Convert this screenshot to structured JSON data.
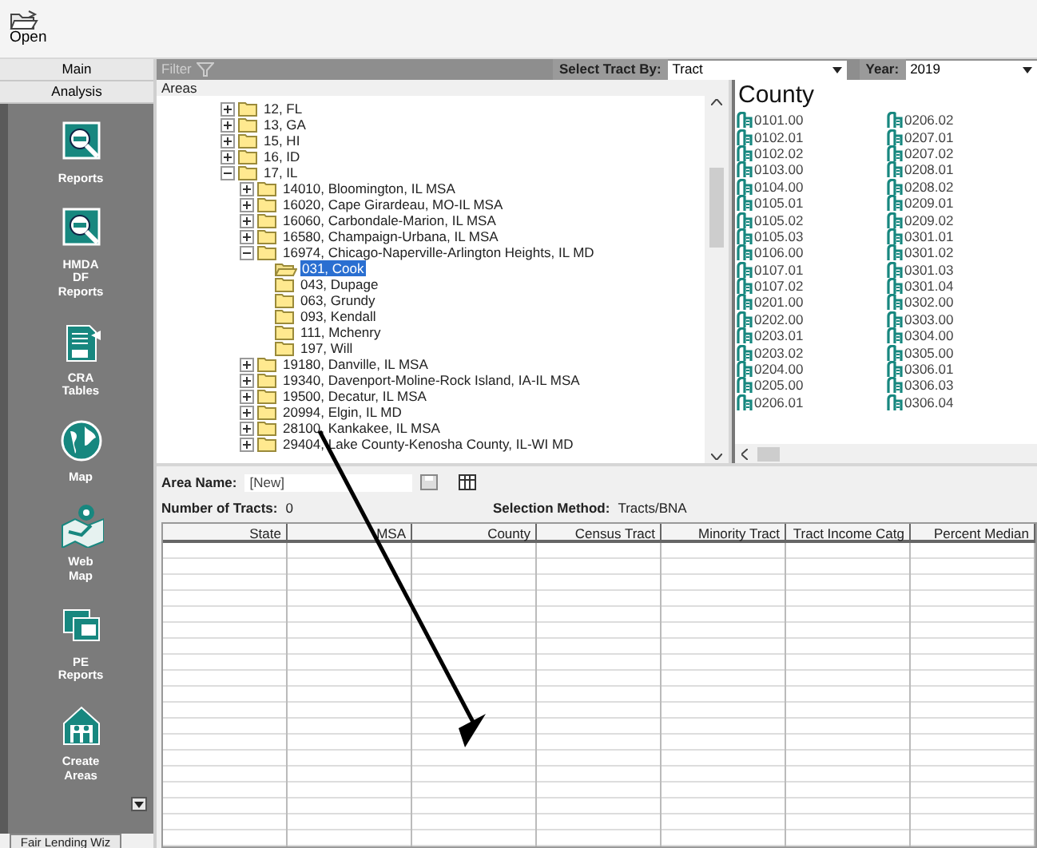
{
  "toolbar": [
    {
      "label": "Open"
    }
  ],
  "sidebar": {
    "tabs": [
      {
        "label": "Main"
      },
      {
        "label": "Analysis"
      }
    ],
    "items": [
      {
        "label": "Reports",
        "kind": "reports"
      },
      {
        "label": "HMDA DF Reports",
        "kind": "reports"
      },
      {
        "label": "CRA Tables",
        "kind": "cra"
      },
      {
        "label": "Map",
        "kind": "globe"
      },
      {
        "label": "Web Map",
        "kind": "webmap"
      },
      {
        "label": "PE Reports",
        "kind": "pe"
      },
      {
        "label": "Create Areas",
        "kind": "house"
      }
    ],
    "bottom_tab": "Fair Lending Wiz"
  },
  "filter_bar": {
    "label": "Filter",
    "select_tract_label": "Select Tract By:",
    "select_tract_value": "Tract",
    "year_label": "Year:",
    "year_value": "2019"
  },
  "areas": {
    "header": "Areas",
    "tree": [
      {
        "label": "12, FL",
        "expanded": false,
        "selected": false
      },
      {
        "label": "13, GA",
        "expanded": false,
        "selected": false
      },
      {
        "label": "15, HI",
        "expanded": false,
        "selected": false
      },
      {
        "label": "16, ID",
        "expanded": false,
        "selected": false
      },
      {
        "label": "17, IL",
        "expanded": true,
        "selected": false,
        "children": [
          {
            "label": "14010, Bloomington, IL MSA",
            "expanded": false,
            "selected": false
          },
          {
            "label": "16020, Cape Girardeau, MO-IL MSA",
            "expanded": false,
            "selected": false
          },
          {
            "label": "16060, Carbondale-Marion, IL MSA",
            "expanded": false,
            "selected": false
          },
          {
            "label": "16580, Champaign-Urbana, IL MSA",
            "expanded": false,
            "selected": false
          },
          {
            "label": "16974, Chicago-Naperville-Arlington Heights, IL MD",
            "expanded": true,
            "selected": false,
            "children": [
              {
                "label": "031, Cook",
                "selected": true
              },
              {
                "label": "043, Dupage",
                "selected": false
              },
              {
                "label": "063, Grundy",
                "selected": false
              },
              {
                "label": "093, Kendall",
                "selected": false
              },
              {
                "label": "111, Mchenry",
                "selected": false
              },
              {
                "label": "197, Will",
                "selected": false
              }
            ]
          },
          {
            "label": "19180, Danville, IL MSA",
            "expanded": false,
            "selected": false
          },
          {
            "label": "19340, Davenport-Moline-Rock Island, IA-IL MSA",
            "expanded": false,
            "selected": false
          },
          {
            "label": "19500, Decatur, IL MSA",
            "expanded": false,
            "selected": false
          },
          {
            "label": "20994, Elgin, IL MD",
            "expanded": false,
            "selected": false
          },
          {
            "label": "28100, Kankakee, IL MSA",
            "expanded": false,
            "selected": false
          },
          {
            "label": "29404, Lake County-Kenosha County, IL-WI MD",
            "expanded": false,
            "selected": false
          }
        ]
      }
    ]
  },
  "county": {
    "title": "County",
    "tracts": [
      "0101.00",
      "0102.01",
      "0102.02",
      "0103.00",
      "0104.00",
      "0105.01",
      "0105.02",
      "0105.03",
      "0106.00",
      "0107.01",
      "0107.02",
      "0201.00",
      "0202.00",
      "0203.01",
      "0203.02",
      "0204.00",
      "0205.00",
      "0206.01",
      "0206.02",
      "0207.01",
      "0207.02",
      "0208.01",
      "0208.02",
      "0209.01",
      "0209.02",
      "0301.01",
      "0301.02",
      "0301.03",
      "0301.04",
      "0302.00",
      "0303.00",
      "0304.00",
      "0305.00",
      "0306.01",
      "0306.03",
      "0306.04"
    ]
  },
  "area_form": {
    "area_name_label": "Area Name:",
    "area_name_value": "[New]",
    "tracts_label": "Number of Tracts:",
    "tracts_count": "0",
    "method_label": "Selection Method:",
    "method_value": "Tracts/BNA"
  },
  "table": {
    "columns": [
      "State",
      "MSA",
      "County",
      "Census Tract",
      "Minority Tract",
      "Tract Income Catg",
      "Percent Median"
    ]
  }
}
